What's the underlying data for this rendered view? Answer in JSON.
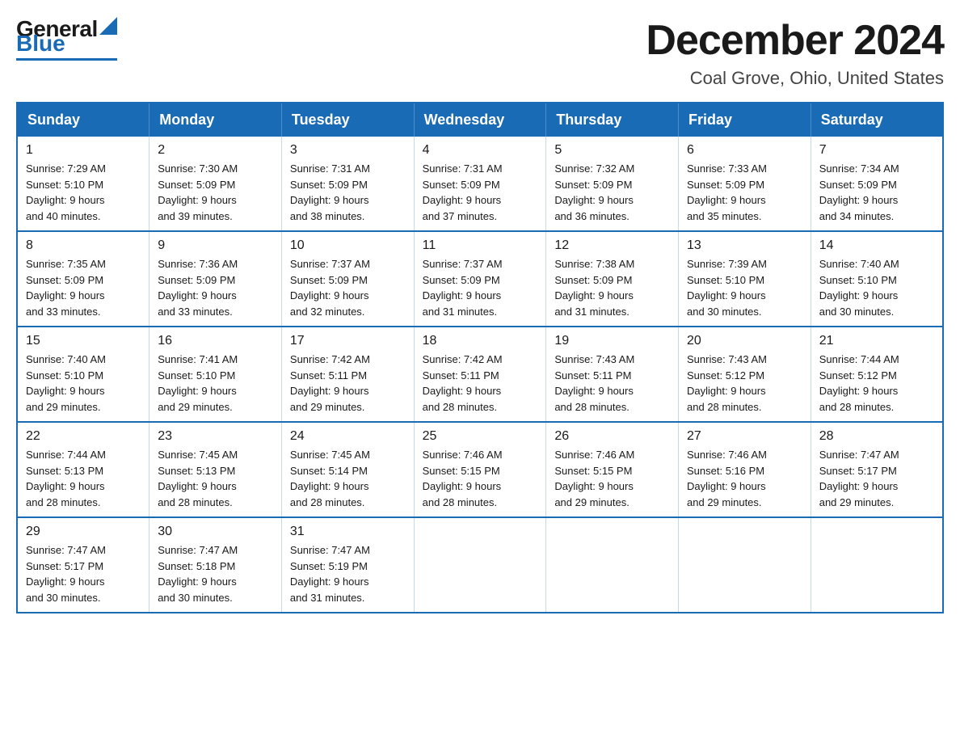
{
  "logo": {
    "general": "General",
    "blue": "Blue",
    "triangle": "▲"
  },
  "title": "December 2024",
  "subtitle": "Coal Grove, Ohio, United States",
  "days_of_week": [
    "Sunday",
    "Monday",
    "Tuesday",
    "Wednesday",
    "Thursday",
    "Friday",
    "Saturday"
  ],
  "weeks": [
    [
      {
        "day": "1",
        "sunrise": "7:29 AM",
        "sunset": "5:10 PM",
        "daylight": "9 hours and 40 minutes."
      },
      {
        "day": "2",
        "sunrise": "7:30 AM",
        "sunset": "5:09 PM",
        "daylight": "9 hours and 39 minutes."
      },
      {
        "day": "3",
        "sunrise": "7:31 AM",
        "sunset": "5:09 PM",
        "daylight": "9 hours and 38 minutes."
      },
      {
        "day": "4",
        "sunrise": "7:31 AM",
        "sunset": "5:09 PM",
        "daylight": "9 hours and 37 minutes."
      },
      {
        "day": "5",
        "sunrise": "7:32 AM",
        "sunset": "5:09 PM",
        "daylight": "9 hours and 36 minutes."
      },
      {
        "day": "6",
        "sunrise": "7:33 AM",
        "sunset": "5:09 PM",
        "daylight": "9 hours and 35 minutes."
      },
      {
        "day": "7",
        "sunrise": "7:34 AM",
        "sunset": "5:09 PM",
        "daylight": "9 hours and 34 minutes."
      }
    ],
    [
      {
        "day": "8",
        "sunrise": "7:35 AM",
        "sunset": "5:09 PM",
        "daylight": "9 hours and 33 minutes."
      },
      {
        "day": "9",
        "sunrise": "7:36 AM",
        "sunset": "5:09 PM",
        "daylight": "9 hours and 33 minutes."
      },
      {
        "day": "10",
        "sunrise": "7:37 AM",
        "sunset": "5:09 PM",
        "daylight": "9 hours and 32 minutes."
      },
      {
        "day": "11",
        "sunrise": "7:37 AM",
        "sunset": "5:09 PM",
        "daylight": "9 hours and 31 minutes."
      },
      {
        "day": "12",
        "sunrise": "7:38 AM",
        "sunset": "5:09 PM",
        "daylight": "9 hours and 31 minutes."
      },
      {
        "day": "13",
        "sunrise": "7:39 AM",
        "sunset": "5:10 PM",
        "daylight": "9 hours and 30 minutes."
      },
      {
        "day": "14",
        "sunrise": "7:40 AM",
        "sunset": "5:10 PM",
        "daylight": "9 hours and 30 minutes."
      }
    ],
    [
      {
        "day": "15",
        "sunrise": "7:40 AM",
        "sunset": "5:10 PM",
        "daylight": "9 hours and 29 minutes."
      },
      {
        "day": "16",
        "sunrise": "7:41 AM",
        "sunset": "5:10 PM",
        "daylight": "9 hours and 29 minutes."
      },
      {
        "day": "17",
        "sunrise": "7:42 AM",
        "sunset": "5:11 PM",
        "daylight": "9 hours and 29 minutes."
      },
      {
        "day": "18",
        "sunrise": "7:42 AM",
        "sunset": "5:11 PM",
        "daylight": "9 hours and 28 minutes."
      },
      {
        "day": "19",
        "sunrise": "7:43 AM",
        "sunset": "5:11 PM",
        "daylight": "9 hours and 28 minutes."
      },
      {
        "day": "20",
        "sunrise": "7:43 AM",
        "sunset": "5:12 PM",
        "daylight": "9 hours and 28 minutes."
      },
      {
        "day": "21",
        "sunrise": "7:44 AM",
        "sunset": "5:12 PM",
        "daylight": "9 hours and 28 minutes."
      }
    ],
    [
      {
        "day": "22",
        "sunrise": "7:44 AM",
        "sunset": "5:13 PM",
        "daylight": "9 hours and 28 minutes."
      },
      {
        "day": "23",
        "sunrise": "7:45 AM",
        "sunset": "5:13 PM",
        "daylight": "9 hours and 28 minutes."
      },
      {
        "day": "24",
        "sunrise": "7:45 AM",
        "sunset": "5:14 PM",
        "daylight": "9 hours and 28 minutes."
      },
      {
        "day": "25",
        "sunrise": "7:46 AM",
        "sunset": "5:15 PM",
        "daylight": "9 hours and 28 minutes."
      },
      {
        "day": "26",
        "sunrise": "7:46 AM",
        "sunset": "5:15 PM",
        "daylight": "9 hours and 29 minutes."
      },
      {
        "day": "27",
        "sunrise": "7:46 AM",
        "sunset": "5:16 PM",
        "daylight": "9 hours and 29 minutes."
      },
      {
        "day": "28",
        "sunrise": "7:47 AM",
        "sunset": "5:17 PM",
        "daylight": "9 hours and 29 minutes."
      }
    ],
    [
      {
        "day": "29",
        "sunrise": "7:47 AM",
        "sunset": "5:17 PM",
        "daylight": "9 hours and 30 minutes."
      },
      {
        "day": "30",
        "sunrise": "7:47 AM",
        "sunset": "5:18 PM",
        "daylight": "9 hours and 30 minutes."
      },
      {
        "day": "31",
        "sunrise": "7:47 AM",
        "sunset": "5:19 PM",
        "daylight": "9 hours and 31 minutes."
      },
      null,
      null,
      null,
      null
    ]
  ]
}
